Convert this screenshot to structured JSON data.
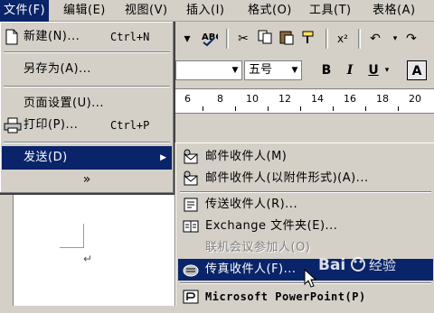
{
  "menubar": {
    "items": [
      {
        "label": "文件(F)",
        "active": true
      },
      {
        "label": "编辑(E)"
      },
      {
        "label": "视图(V)"
      },
      {
        "label": "插入(I)"
      },
      {
        "label": "格式(O)"
      },
      {
        "label": "工具(T)"
      },
      {
        "label": "表格(A)"
      }
    ]
  },
  "file_menu": {
    "items": [
      {
        "label": "新建(N)...",
        "accel": "Ctrl+N",
        "icon": "new-document-icon"
      },
      {
        "label": "另存为(A)..."
      },
      {
        "label": "页面设置(U)..."
      },
      {
        "label": "打印(P)...",
        "accel": "Ctrl+P",
        "icon": "printer-icon"
      },
      {
        "label": "发送(D)",
        "submenu": true,
        "highlighted": true
      }
    ],
    "expand_glyph": "»"
  },
  "send_menu": {
    "items": [
      {
        "label": "邮件收件人(M)",
        "icon": "mail-recipient-icon"
      },
      {
        "label": "邮件收件人(以附件形式)(A)...",
        "icon": "mail-attachment-icon"
      },
      {
        "label": "传送收件人(R)...",
        "icon": "routing-slip-icon"
      },
      {
        "label": "Exchange 文件夹(E)...",
        "icon": "exchange-folder-icon"
      },
      {
        "label": "联机会议参加人(O)",
        "disabled": true
      },
      {
        "label": "传真收件人(F)...",
        "icon": "fax-recipient-icon",
        "highlighted": true
      },
      {
        "label": "Microsoft PowerPoint(P)",
        "icon": "powerpoint-icon"
      }
    ]
  },
  "toolbar": {
    "font_size": "五号",
    "bold": "B",
    "italic": "I",
    "underline": "U",
    "font_color": "A",
    "superscript": "x²"
  },
  "ruler": {
    "numbers": [
      "6",
      "8",
      "10",
      "12",
      "14",
      "16",
      "18",
      "20"
    ]
  },
  "document": {
    "paragraph_mark": "↵"
  },
  "watermark": {
    "text": "Bai 经验"
  },
  "colors": {
    "menu_face": "#d4d0c8",
    "highlight": "#0a246a",
    "highlight_text": "#ffffff",
    "disabled_text": "#808080"
  }
}
